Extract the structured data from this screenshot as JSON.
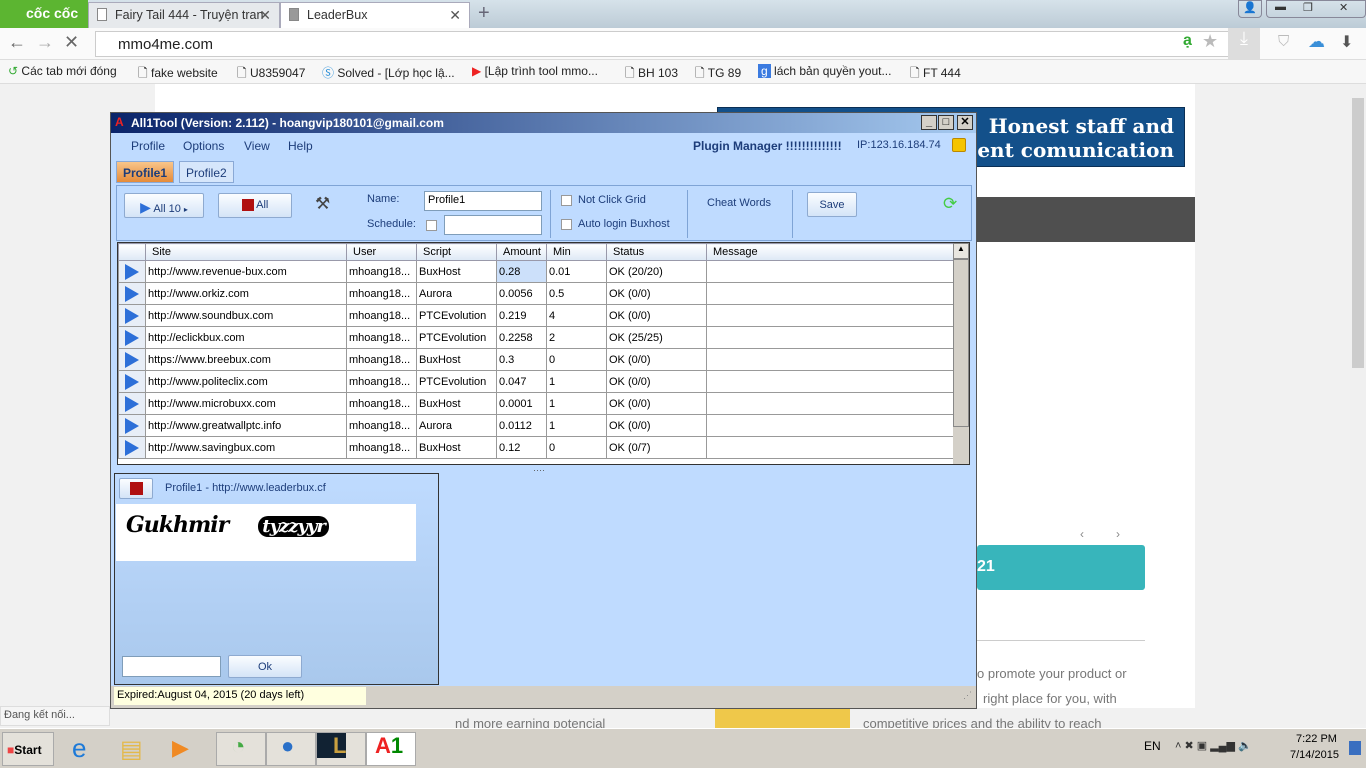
{
  "browser": {
    "logo": "cốc cốc",
    "tabs": [
      {
        "label": "Fairy Tail 444 - Truyện tran"
      },
      {
        "label": "LeaderBux"
      }
    ],
    "url": "mmo4me.com",
    "bookmarks": [
      "Các tab mới đóng",
      "fake website",
      "U8359047",
      "Solved - [Lớp học lậ...",
      "[Lập trình tool mmo...",
      "BH 103",
      "TG 89",
      "lách bản quyền yout...",
      "FT 444"
    ],
    "status": "Đang kết nối..."
  },
  "web": {
    "banner_line1": "Honest staff and",
    "banner_line2": "xcelent comunication",
    "teal_button": "21",
    "text1": "o promote your product or",
    "text2": "right place for you, with",
    "text3": "competitive prices and the ability to reach",
    "text4": "nd more earning potencial"
  },
  "app": {
    "title": "All1Tool (Version: 2.112) - hoangvip180101@gmail.com",
    "menu": [
      "Profile",
      "Options",
      "View",
      "Help"
    ],
    "plugin_manager": "Plugin Manager !!!!!!!!!!!!!!",
    "ip": "IP:123.16.184.74",
    "profile_tabs": [
      "Profile1",
      "Profile2"
    ],
    "toolbar": {
      "run_all": "All 10",
      "stop_all": "All",
      "name_label": "Name:",
      "name_value": "Profile1",
      "schedule_label": "Schedule:",
      "not_click_grid": "Not Click Grid",
      "auto_login": "Auto login Buxhost",
      "cheat_words": "Cheat Words",
      "save": "Save"
    },
    "columns": [
      "Site",
      "User",
      "Script",
      "Amount",
      "Min",
      "Status",
      "Message"
    ],
    "rows": [
      [
        "http://www.revenue-bux.com",
        "mhoang18...",
        "BuxHost",
        "0.28",
        "0.01",
        "OK (20/20)",
        ""
      ],
      [
        "http://www.orkiz.com",
        "mhoang18...",
        "Aurora",
        "0.0056",
        "0.5",
        "OK (0/0)",
        ""
      ],
      [
        "http://www.soundbux.com",
        "mhoang18...",
        "PTCEvolution",
        "0.219",
        "4",
        "OK (0/0)",
        ""
      ],
      [
        "http://eclickbux.com",
        "mhoang18...",
        "PTCEvolution",
        "0.2258",
        "2",
        "OK (25/25)",
        ""
      ],
      [
        "https://www.breebux.com",
        "mhoang18...",
        "BuxHost",
        "0.3",
        "0",
        "OK (0/0)",
        ""
      ],
      [
        "http://www.politeclix.com",
        "mhoang18...",
        "PTCEvolution",
        "0.047",
        "1",
        "OK (0/0)",
        ""
      ],
      [
        "http://www.microbuxx.com",
        "mhoang18...",
        "BuxHost",
        "0.0001",
        "1",
        "OK (0/0)",
        ""
      ],
      [
        "http://www.greatwallptc.info",
        "mhoang18...",
        "Aurora",
        "0.0112",
        "1",
        "OK (0/0)",
        ""
      ],
      [
        "http://www.savingbux.com",
        "mhoang18...",
        "BuxHost",
        "0.12",
        "0",
        "OK (0/7)",
        ""
      ]
    ],
    "captcha": {
      "title": "Profile1 - http://www.leaderbux.cf",
      "ok": "Ok",
      "image_text": "Gukhmir tyzzyyr"
    },
    "expired": "Expired:August 04, 2015 (20 days left)"
  },
  "taskbar": {
    "start": "Start",
    "lang": "EN",
    "time": "7:22 PM",
    "date": "7/14/2015"
  }
}
